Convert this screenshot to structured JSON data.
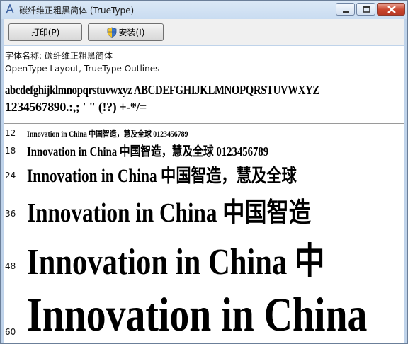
{
  "window": {
    "title": "碳纤维正粗黑简体 (TrueType)"
  },
  "toolbar": {
    "print_label": "打印(P)",
    "install_label": "安装(I)"
  },
  "info": {
    "font_name": "字体名称: 碳纤维正粗黑简体",
    "layout": "OpenType Layout, TrueType Outlines"
  },
  "charset": {
    "line1": "abcdefghijklmnopqrstuvwxyz ABCDEFGHIJKLMNOPQRSTUVWXYZ",
    "line2": "1234567890.:,; ' \" (!?) +-*/="
  },
  "samples": [
    {
      "size": "12",
      "latin": "Innovation in China ",
      "cjk": "中国智造，慧及全球",
      "tail": " 0123456789"
    },
    {
      "size": "18",
      "latin": "Innovation in China ",
      "cjk": "中国智造，慧及全球",
      "tail": " 0123456789"
    },
    {
      "size": "24",
      "latin": "Innovation in China ",
      "cjk": "中国智造，慧及全球",
      "tail": ""
    },
    {
      "size": "36",
      "latin": "Innovation in China ",
      "cjk": "中国智造",
      "tail": ""
    },
    {
      "size": "48",
      "latin": "Innovation in China ",
      "cjk": "中",
      "tail": ""
    },
    {
      "size": "60",
      "latin": "Innovation in China",
      "cjk": "",
      "tail": ""
    }
  ],
  "icons": {
    "app": "font-icon",
    "install": "shield-icon"
  },
  "colors": {
    "title_bar": "#c9dcf1",
    "close_button": "#c9462f"
  }
}
